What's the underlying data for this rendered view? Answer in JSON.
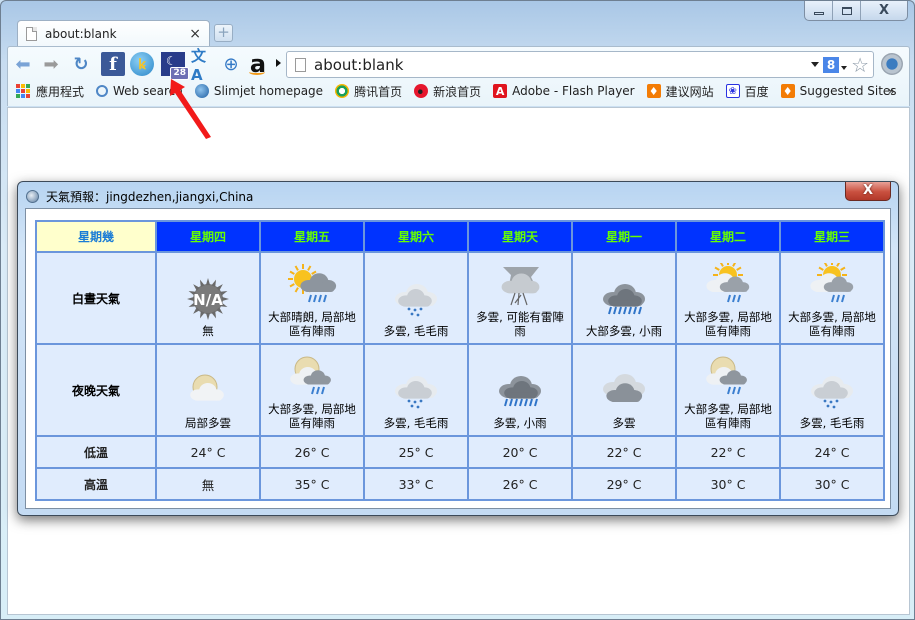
{
  "window": {
    "controls": {
      "minimize": "—",
      "maximize": "□",
      "close": "X"
    }
  },
  "tab": {
    "title": "about:blank",
    "close_glyph": "×"
  },
  "toolbar": {
    "address_value": "about:blank",
    "search_engine_glyph": "8",
    "star_glyph": "☆",
    "extensions": [
      {
        "name": "facebook",
        "glyph": "f"
      },
      {
        "name": "password-key",
        "glyph": "🔑"
      },
      {
        "name": "lunar-calendar",
        "glyph": "☾",
        "badge": "28"
      },
      {
        "name": "translate",
        "glyph": "文A"
      },
      {
        "name": "zoom",
        "glyph": "🔍"
      },
      {
        "name": "amazon",
        "glyph": "a"
      }
    ]
  },
  "bookmarks": [
    {
      "label": "應用程式",
      "icon": "apps-icon"
    },
    {
      "label": "Web search",
      "icon": "search-icon"
    },
    {
      "label": "Slimjet homepage",
      "icon": "globe-icon"
    },
    {
      "label": "腾讯首页",
      "icon": "qq-icon"
    },
    {
      "label": "新浪首页",
      "icon": "weibo-icon"
    },
    {
      "label": "Adobe - Flash Player",
      "icon": "adobe-icon"
    },
    {
      "label": "建议网站",
      "icon": "bulb-icon"
    },
    {
      "label": "百度",
      "icon": "baidu-paw-icon"
    },
    {
      "label": "Suggested Sites",
      "icon": "bulb-icon"
    }
  ],
  "bookmarks_overflow": "»",
  "dialog": {
    "title": "天氣預報：jingdezhen,jiangxi,China",
    "close_glyph": "X",
    "corner_header": "星期幾",
    "days": [
      "星期四",
      "星期五",
      "星期六",
      "星期天",
      "星期一",
      "星期二",
      "星期三"
    ],
    "rows": {
      "day_label": "白晝天氣",
      "night_label": "夜晚天氣",
      "low_label": "低溫",
      "high_label": "高溫"
    },
    "day_weather": [
      {
        "icon": "na",
        "text": "無"
      },
      {
        "icon": "sun-shower",
        "text": "大部晴朗, 局部地區有陣雨"
      },
      {
        "icon": "drizzle",
        "text": "多雲, 毛毛雨"
      },
      {
        "icon": "thunderstorm",
        "text": "多雲, 可能有雷陣雨"
      },
      {
        "icon": "rain",
        "text": "大部多雲, 小雨"
      },
      {
        "icon": "sun-cloud-shower",
        "text": "大部多雲, 局部地區有陣雨"
      },
      {
        "icon": "sun-cloud-shower",
        "text": "大部多雲, 局部地區有陣雨"
      }
    ],
    "night_weather": [
      {
        "icon": "moon-cloud",
        "text": "局部多雲"
      },
      {
        "icon": "moon-cloud-shower",
        "text": "大部多雲, 局部地區有陣雨"
      },
      {
        "icon": "drizzle",
        "text": "多雲, 毛毛雨"
      },
      {
        "icon": "rain",
        "text": "多雲, 小雨"
      },
      {
        "icon": "cloudy",
        "text": "多雲"
      },
      {
        "icon": "moon-cloud-shower",
        "text": "大部多雲, 局部地區有陣雨"
      },
      {
        "icon": "drizzle",
        "text": "多雲, 毛毛雨"
      }
    ],
    "low_temps": [
      "24° C",
      "26° C",
      "25° C",
      "20° C",
      "22° C",
      "22° C",
      "24° C"
    ],
    "high_temps": [
      "無",
      "35° C",
      "33° C",
      "26° C",
      "29° C",
      "30° C",
      "30° C"
    ]
  }
}
